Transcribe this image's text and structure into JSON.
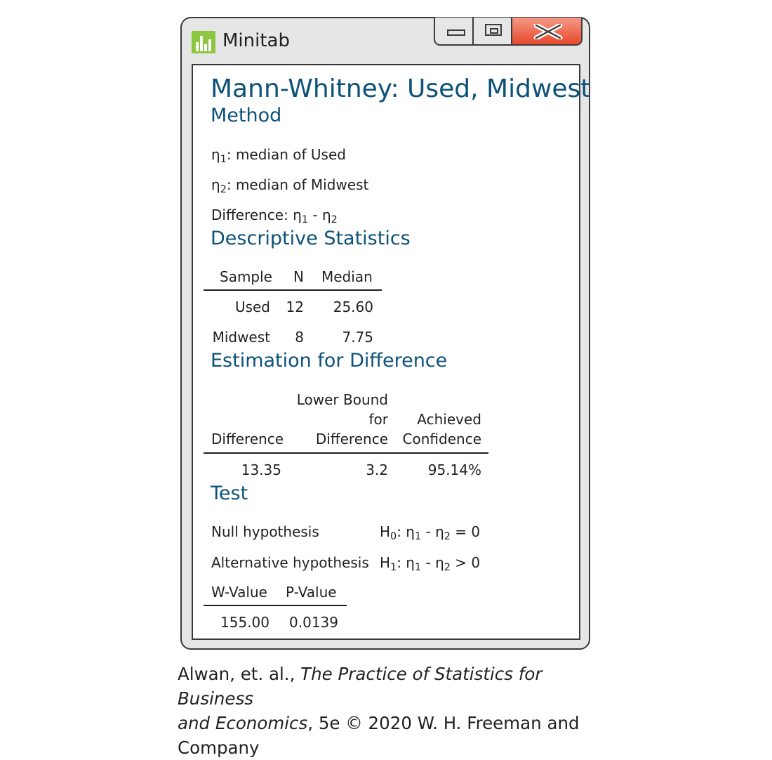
{
  "window": {
    "app_title": "Minitab",
    "app_icon": "minitab-bars-icon",
    "controls": {
      "minimize": "minimize-icon",
      "maximize": "maximize-icon",
      "close": "close-icon"
    },
    "colors": {
      "icon_green": "#8dc63f",
      "close_red": "#e7482c",
      "heading_blue": "#0c5279"
    }
  },
  "report": {
    "title": "Mann-Whitney: Used, Midwest",
    "method": {
      "heading": "Method",
      "eta1_prefix": "η",
      "eta1_sub": "1",
      "eta1_text": ": median of Used",
      "eta2_prefix": "η",
      "eta2_sub": "2",
      "eta2_text": ": median of Midwest",
      "difference_label": "Difference: η",
      "difference_sub1": "1",
      "difference_mid": " - η",
      "difference_sub2": "2"
    },
    "descriptive": {
      "heading": "Descriptive Statistics",
      "columns": [
        "Sample",
        "N",
        "Median"
      ],
      "rows": [
        [
          "Used",
          "12",
          "25.60"
        ],
        [
          "Midwest",
          "8",
          "7.75"
        ]
      ]
    },
    "estimation": {
      "heading": "Estimation for Difference",
      "col_difference": "Difference",
      "col_lower_line1": "Lower Bound",
      "col_lower_line2": "for",
      "col_lower_line3": "Difference",
      "col_achieved_line1": "Achieved",
      "col_achieved_line2": "Confidence",
      "row": [
        "13.35",
        "3.2",
        "95.14%"
      ]
    },
    "test": {
      "heading": "Test",
      "null_label": "Null hypothesis",
      "null_h": "H",
      "null_h_sub": "0",
      "null_colon": ": η",
      "null_sub1": "1",
      "null_mid": " - η",
      "null_sub2": "2",
      "null_tail": " = 0",
      "alt_label": "Alternative hypothesis",
      "alt_h": "H",
      "alt_h_sub": "1",
      "alt_colon": ": η",
      "alt_sub1": "1",
      "alt_mid": " - η",
      "alt_sub2": "2",
      "alt_tail": " > 0",
      "columns": [
        "W-Value",
        "P-Value"
      ],
      "row": [
        "155.00",
        "0.0139"
      ]
    }
  },
  "caption": {
    "authors": "Alwan, et. al., ",
    "book_title_part1": "The Practice of Statistics for Business",
    "book_title_part2": "and Economics",
    "edition_line1": ", 5e © 2020 W. H. Freeman and",
    "edition_line2": "Company"
  }
}
